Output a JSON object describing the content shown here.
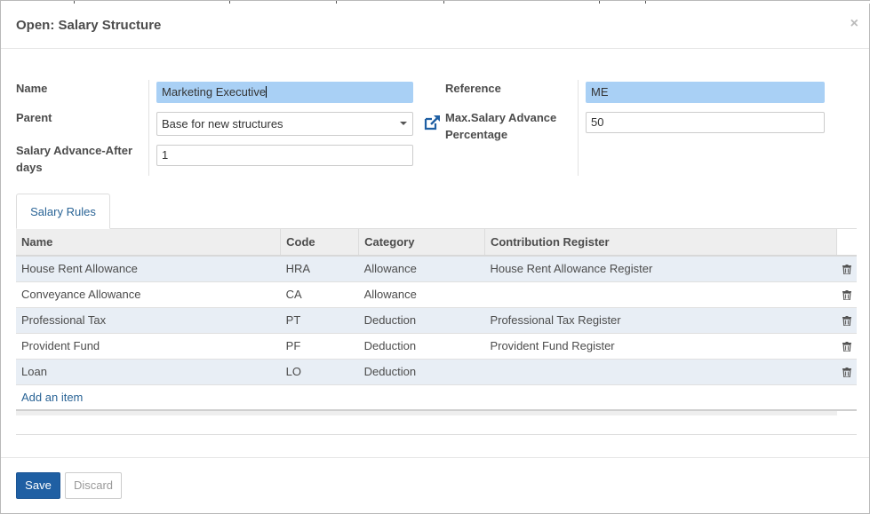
{
  "dialog": {
    "title": "Open: Salary Structure",
    "close_label": "×"
  },
  "form": {
    "name_label": "Name",
    "name_value": "Marketing Executive",
    "parent_label": "Parent",
    "parent_value": "Base for new structures",
    "advance_after_label_1": "Salary Advance-After",
    "advance_after_label_2": "days",
    "advance_after_value": "1",
    "reference_label": "Reference",
    "reference_value": "ME",
    "max_advance_label_1": "Max.Salary Advance",
    "max_advance_label_2": "Percentage",
    "max_advance_value": "50"
  },
  "tabs": [
    {
      "label": "Salary Rules",
      "active": true
    }
  ],
  "rules_table": {
    "columns": [
      "Name",
      "Code",
      "Category",
      "Contribution Register"
    ],
    "rows": [
      {
        "name": "House Rent Allowance",
        "code": "HRA",
        "category": "Allowance",
        "register": "House Rent Allowance Register"
      },
      {
        "name": "Conveyance Allowance",
        "code": "CA",
        "category": "Allowance",
        "register": ""
      },
      {
        "name": "Professional Tax",
        "code": "PT",
        "category": "Deduction",
        "register": "Professional Tax Register"
      },
      {
        "name": "Provident Fund",
        "code": "PF",
        "category": "Deduction",
        "register": "Provident Fund Register"
      },
      {
        "name": "Loan",
        "code": "LO",
        "category": "Deduction",
        "register": ""
      }
    ],
    "add_item_label": "Add an item"
  },
  "buttons": {
    "save_label": "Save",
    "discard_label": "Discard"
  },
  "colors": {
    "primary": "#1f5fa3",
    "required_field": "#a9d0f5",
    "link": "#2a6496",
    "odd_row": "#e8eef5"
  },
  "icons": {
    "close": "close-icon",
    "external_link": "external-link-icon",
    "delete": "trash-icon",
    "dropdown": "chevron-down-icon"
  }
}
